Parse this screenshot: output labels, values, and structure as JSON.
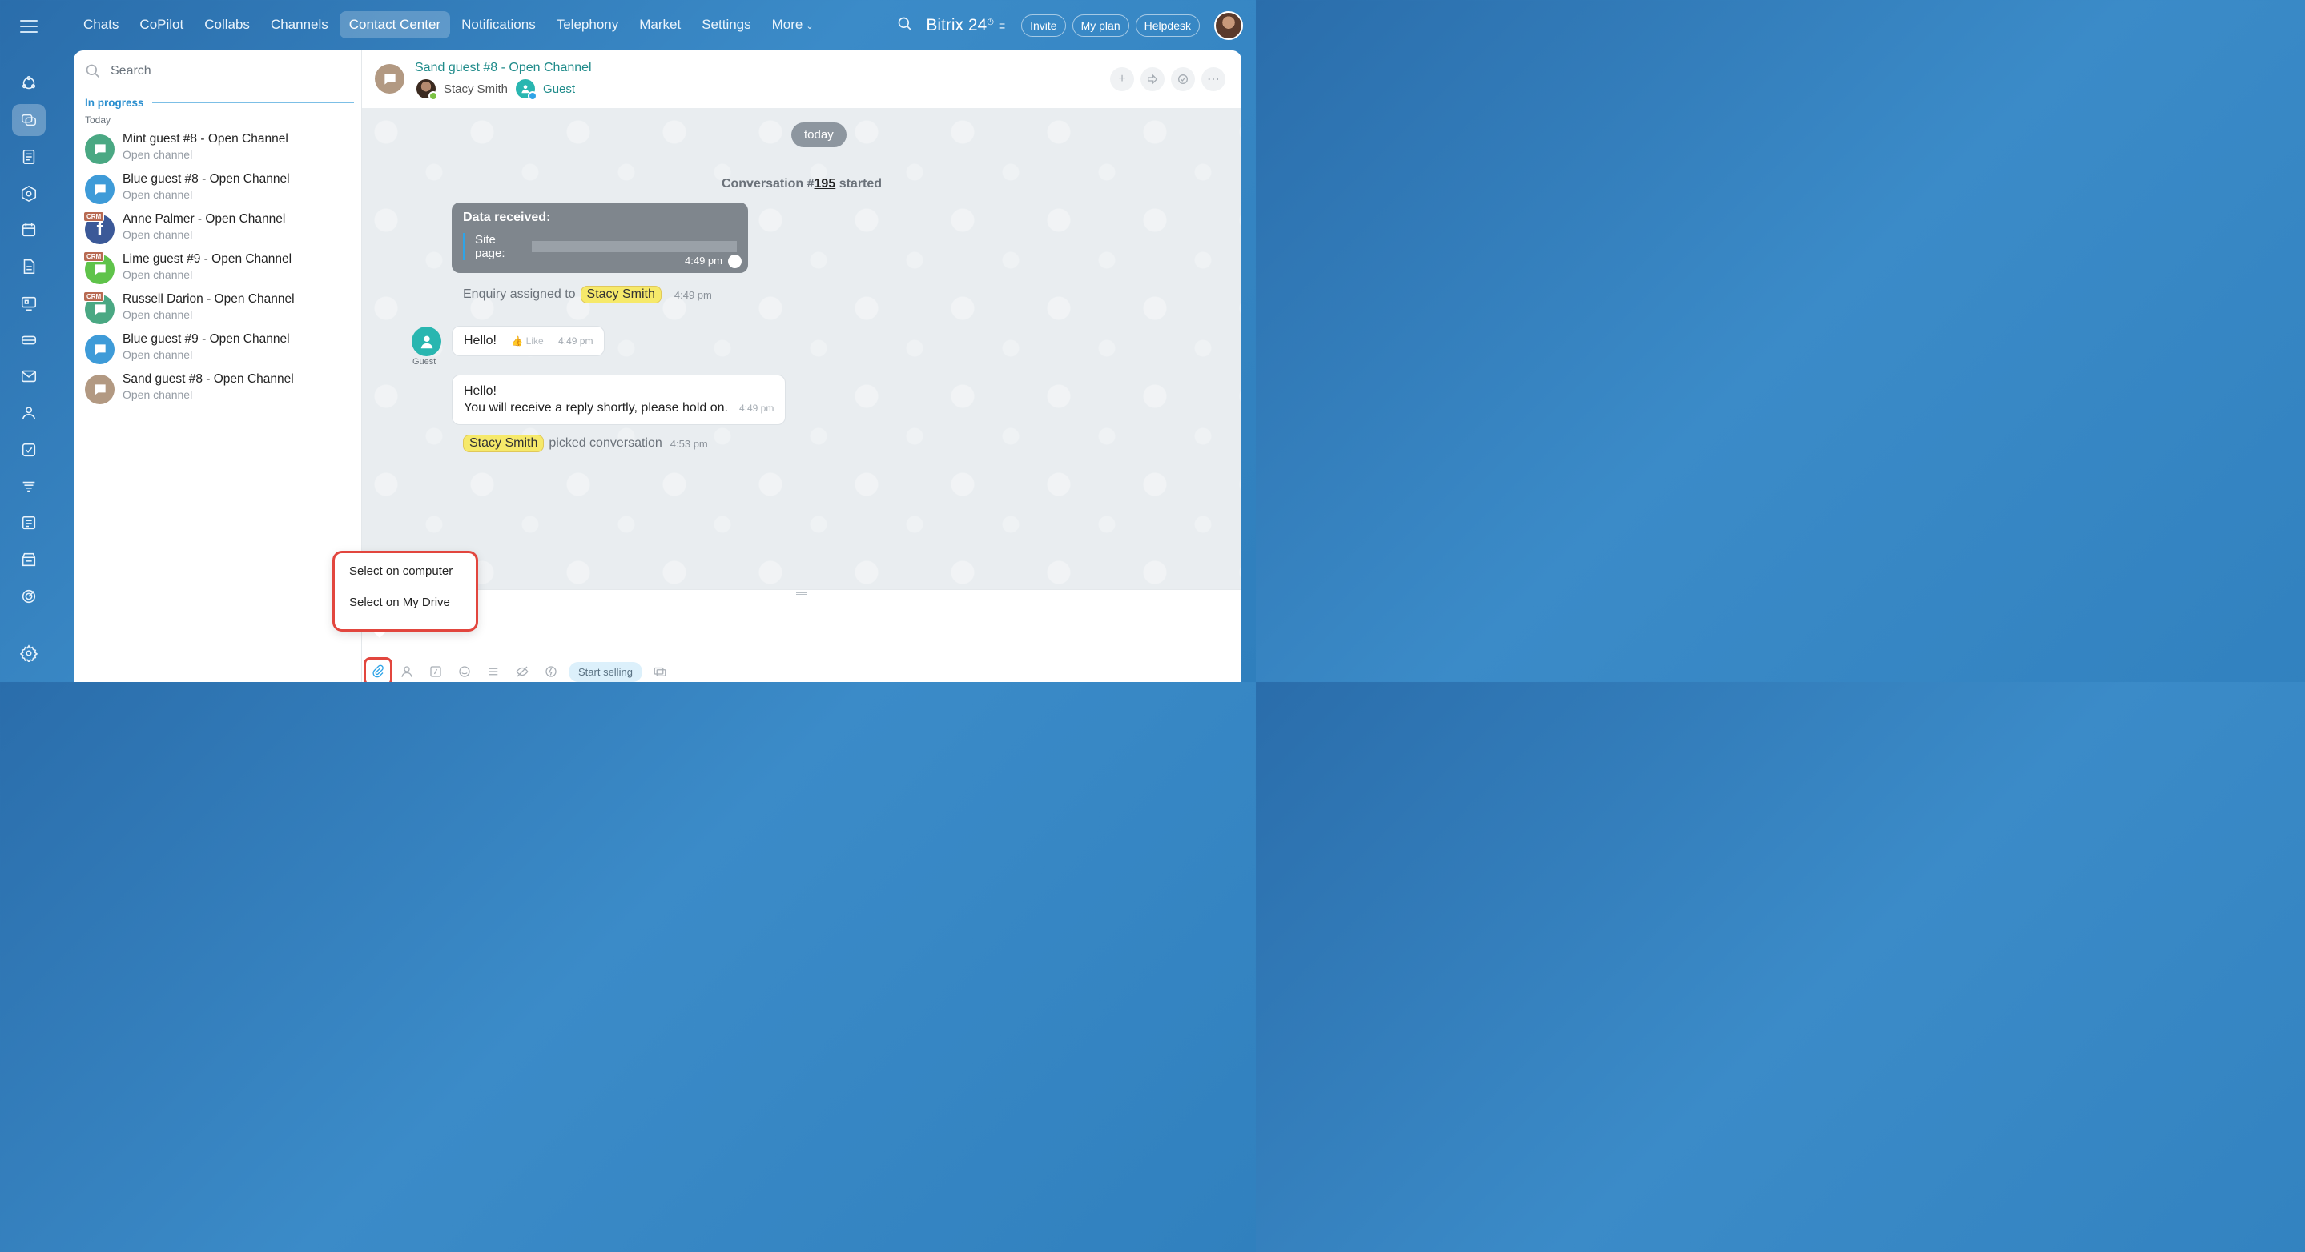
{
  "nav": {
    "items": [
      "Chats",
      "CoPilot",
      "Collabs",
      "Channels",
      "Contact Center",
      "Notifications",
      "Telephony",
      "Market",
      "Settings",
      "More"
    ],
    "active": "Contact Center"
  },
  "topright": {
    "brand": "Bitrix 24",
    "invite": "Invite",
    "my_plan": "My plan",
    "helpdesk": "Helpdesk"
  },
  "rail": {
    "icons": [
      "hamburger-menu-icon",
      "feed-icon",
      "messenger-icon",
      "tasks-docs-icon",
      "hexagon-icon",
      "calendar-icon",
      "document-icon",
      "sites-icon",
      "inventory-icon",
      "mail-icon",
      "employees-icon",
      "checklist-icon",
      "filter-icon",
      "workflow-icon",
      "store-icon",
      "goal-icon",
      "settings-gear-icon"
    ]
  },
  "sidebar": {
    "search_placeholder": "Search",
    "section": "In progress",
    "subsection": "Today",
    "chats": [
      {
        "title": "Mint guest #8 - Open Channel",
        "sub": "Open channel",
        "color": "#4aa883",
        "crm": false
      },
      {
        "title": "Blue guest #8 - Open Channel",
        "sub": "Open channel",
        "color": "#3e9bd8",
        "crm": false
      },
      {
        "title": "Anne Palmer - Open Channel",
        "sub": "Open channel",
        "color": "#3b5998",
        "crm": true
      },
      {
        "title": "Lime guest #9 - Open Channel",
        "sub": "Open channel",
        "color": "#5fc34a",
        "crm": true
      },
      {
        "title": "Russell Darion - Open Channel",
        "sub": "Open channel",
        "color": "#4aa883",
        "crm": true
      },
      {
        "title": "Blue guest #9 - Open Channel",
        "sub": "Open channel",
        "color": "#3e9bd8",
        "crm": false
      },
      {
        "title": "Sand guest #8 - Open Channel",
        "sub": "Open channel",
        "color": "#b29982",
        "crm": false
      }
    ],
    "crm_badge": "CRM"
  },
  "chat": {
    "title": "Sand guest #8 - Open Channel",
    "participant_1": "Stacy Smith",
    "participant_2": "Guest",
    "date_label": "today",
    "conv_prefix": "Conversation #",
    "conv_number": "195",
    "conv_suffix": "started",
    "data_heading": "Data received:",
    "site_page_label": "Site page:",
    "data_time": "4:49 pm",
    "assigned_text": "Enquiry assigned to",
    "assigned_user": "Stacy Smith",
    "assigned_time": "4:49 pm",
    "guest_label": "Guest",
    "msg1_text": "Hello!",
    "msg1_like": "Like",
    "msg1_time": "4:49 pm",
    "msg2_line1": "Hello!",
    "msg2_line2": "You will receive a reply shortly, please hold on.",
    "msg2_time": "4:49 pm",
    "picked_user": "Stacy Smith",
    "picked_text": "picked conversation",
    "picked_time": "4:53 pm"
  },
  "attach_menu": {
    "option_1": "Select on computer",
    "option_2": "Select on My Drive"
  },
  "composer": {
    "start_selling": "Start selling"
  },
  "colors": {
    "accent": "#2fa4e7",
    "highlight_red": "#e2463e",
    "mention_yellow": "#f6e96a",
    "teal": "#1f8b8a"
  }
}
